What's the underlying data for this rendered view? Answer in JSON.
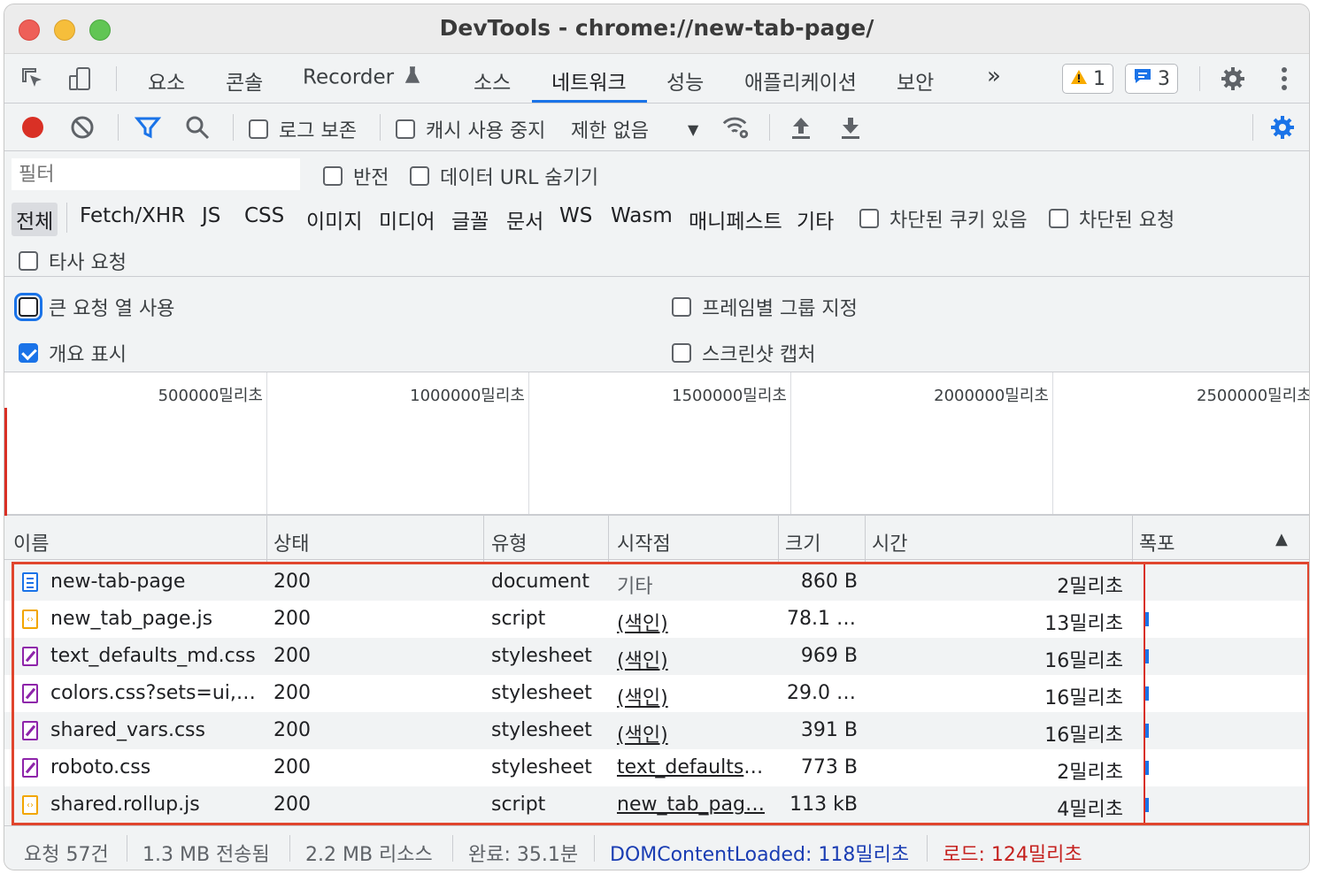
{
  "window": {
    "title": "DevTools - chrome://new-tab-page/"
  },
  "tabs": {
    "items": [
      "요소",
      "콘솔",
      "Recorder",
      "소스",
      "네트워크",
      "성능",
      "애플리케이션",
      "보안"
    ],
    "more": "»",
    "active": "네트워크",
    "warnings": "1",
    "messages": "3"
  },
  "toolbar": {
    "preserve_log": "로그 보존",
    "disable_cache": "캐시 사용 중지",
    "throttling": "제한 없음"
  },
  "filter": {
    "placeholder": "필터",
    "invert": "반전",
    "hide_data_urls": "데이터 URL 숨기기",
    "types": [
      "전체",
      "Fetch/XHR",
      "JS",
      "CSS",
      "이미지",
      "미디어",
      "글꼴",
      "문서",
      "WS",
      "Wasm",
      "매니페스트",
      "기타"
    ],
    "blocked_cookies": "차단된 쿠키 있음",
    "blocked_requests": "차단된 요청",
    "third_party": "타사 요청"
  },
  "settings": {
    "large_rows": "큰 요청 열 사용",
    "group_by_frame": "프레임별 그룹 지정",
    "show_overview": "개요 표시",
    "capture_screenshots": "스크린샷 캡처",
    "show_overview_checked": true
  },
  "overview": {
    "ticks": [
      "500000밀리초",
      "1000000밀리초",
      "1500000밀리초",
      "2000000밀리초",
      "2500000밀리초"
    ]
  },
  "table": {
    "headers": {
      "name": "이름",
      "status": "상태",
      "type": "유형",
      "initiator": "시작점",
      "size": "크기",
      "time": "시간",
      "waterfall": "폭포",
      "sort_indicator": "▲"
    },
    "rows": [
      {
        "icon": "document-icon",
        "name": "new-tab-page",
        "status": "200",
        "type": "document",
        "initiator": "기타",
        "size": "860 B",
        "time": "2밀리초"
      },
      {
        "icon": "script-icon",
        "name": "new_tab_page.js",
        "status": "200",
        "type": "script",
        "initiator": "(색인)",
        "size": "78.1 …",
        "time": "13밀리초"
      },
      {
        "icon": "stylesheet-icon",
        "name": "text_defaults_md.css",
        "status": "200",
        "type": "stylesheet",
        "initiator": "(색인)",
        "size": "969 B",
        "time": "16밀리초"
      },
      {
        "icon": "stylesheet-icon",
        "name": "colors.css?sets=ui,…",
        "status": "200",
        "type": "stylesheet",
        "initiator": "(색인)",
        "size": "29.0 …",
        "time": "16밀리초"
      },
      {
        "icon": "stylesheet-icon",
        "name": "shared_vars.css",
        "status": "200",
        "type": "stylesheet",
        "initiator": "(색인)",
        "size": "391 B",
        "time": "16밀리초"
      },
      {
        "icon": "stylesheet-icon",
        "name": "roboto.css",
        "status": "200",
        "type": "stylesheet",
        "initiator": "text_defaults_…",
        "size": "773 B",
        "time": "2밀리초"
      },
      {
        "icon": "script-icon",
        "name": "shared.rollup.js",
        "status": "200",
        "type": "script",
        "initiator": "new_tab_pag…",
        "size": "113 kB",
        "time": "4밀리초"
      }
    ]
  },
  "status": {
    "requests": "요청 57건",
    "transferred": "1.3 MB 전송됨",
    "resources": "2.2 MB 리소스",
    "finish": "완료: 35.1분",
    "dcl": "DOMContentLoaded: 118밀리초",
    "load": "로드: 124밀리초",
    "dcl_color": "#1a3db3",
    "load_color": "#c5221f"
  },
  "colors": {
    "accent": "#1a73e8",
    "highlight": "#e0452d"
  }
}
